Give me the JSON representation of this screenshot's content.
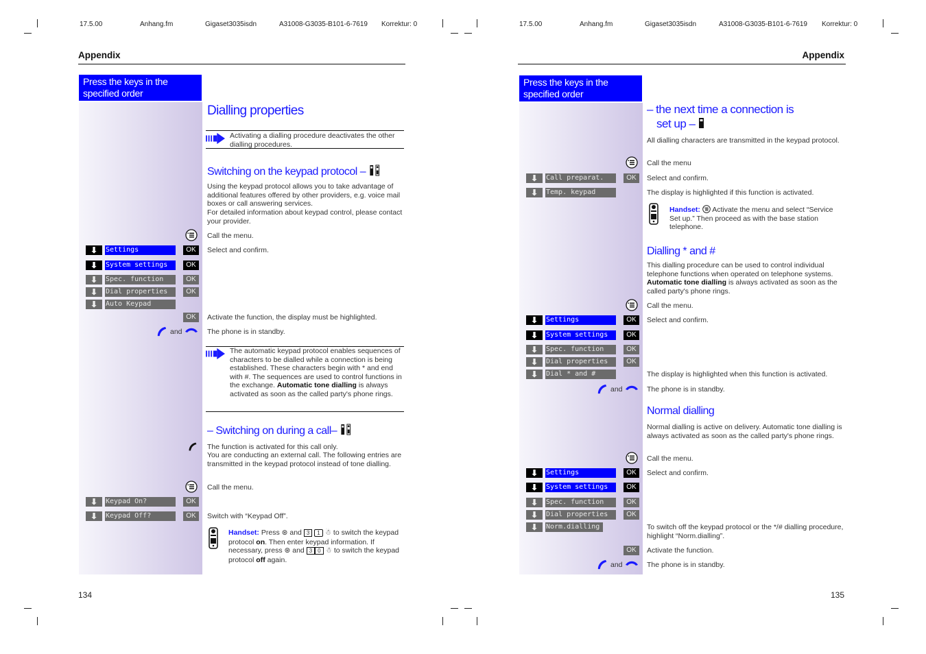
{
  "header": {
    "date": "17.5.00",
    "file": "Anhang.fm",
    "product": "Gigaset3035isdn",
    "docnum": "A31008-G3035-B101-6-7619",
    "correction": "Korrektur: 0"
  },
  "section": "Appendix",
  "key_column_label": "Press the keys in the specified order",
  "common": {
    "call_menu": "Call the menu.",
    "select_confirm": "Select and confirm.",
    "standby": "The phone is in standby.",
    "and": "and",
    "ok": "OK",
    "handset_label": "Handset:"
  },
  "left": {
    "page_number": "134",
    "title": "Dialling properties",
    "note1": "Activating a dialling procedure deactivates the other dialling procedures.",
    "h_keypad": "Switching on the keypad protocol –",
    "p_keypad": "Using the keypad protocol allows you to take advantage of additional features offered by other providers, e.g. voice mail boxes or call answering services.",
    "p_keypad2": "For detailed information about keypad control, please contact your provider.",
    "menu1": [
      "Settings",
      "System settings",
      "Spec. function",
      "Dial properties",
      "Auto Keypad"
    ],
    "activate": "Activate the function, the display must be highlighted.",
    "note2_a": "The automatic keypad protocol enables sequences of characters to be dialled while a connection is being established. These characters begin with * and end with #. The sequences are used to control functions in the exchange.",
    "note2_b": "Automatic tone dialling",
    "note2_c": "is always activated as soon as the called party's phone rings.",
    "h_during": "– Switching on during a call–",
    "p_during": "The function is activated for this call only.",
    "p_during2": "You are conducting an external call. The following entries are transmitted in the keypad protocol instead of tone dialling.",
    "menu2": [
      "Keypad On?",
      "Keypad Off?"
    ],
    "switch_off": "Switch with “Keypad Off”.",
    "handset_note": {
      "t1": "Press",
      "t2": "and",
      "keys_on": [
        "3",
        "1"
      ],
      "t3": "to switch the keypad protocol",
      "on": "on",
      "t4": ". Then enter keypad information. If necessary, press",
      "t5": "and",
      "keys_off": [
        "3",
        "0"
      ],
      "t6": "to switch the keypad protocol",
      "off": "off",
      "t7": "again."
    }
  },
  "right": {
    "page_number": "135",
    "h_next_1": "– the next time a connection is",
    "h_next_2": "set up –",
    "p_next": "All dialling characters are transmitted in the keypad protocol.",
    "call_menu_nodot": "Call the menu",
    "menu_next": [
      "Call preparat.",
      "Temp. keypad"
    ],
    "highlight_if": "The display is highlighted if this function is activated.",
    "handset_note": "Activate the menu and select “Service Set up.” Then proceed as with the base station telephone.",
    "h_star": "Dialling * and #",
    "p_star_a": "This dialling procedure can be used to control individual telephone functions when operated on telephone systems.",
    "p_star_b": "Automatic tone dialling",
    "p_star_c": "is always activated as soon as the called party's phone rings.",
    "menu_star": [
      "Settings",
      "System settings",
      "Spec. function",
      "Dial properties",
      "Dial * and #"
    ],
    "highlight_when": "The display is highlighted when this function is activated.",
    "h_normal": "Normal dialling",
    "p_normal": "Normal dialling is active on delivery. Automatic tone dialling is always activated as soon as the called party's phone rings.",
    "menu_normal": [
      "Settings",
      "System settings",
      "Spec. function",
      "Dial properties",
      "Norm.dialling"
    ],
    "switch_off_text": "To switch off the keypad protocol or the */# dialling procedure, highlight “Norm.dialling”.",
    "activate": "Activate the function."
  },
  "colors": {
    "accent": "#0000ff",
    "heading": "#1a1aff",
    "inactive_key": "#6b6b6b"
  }
}
